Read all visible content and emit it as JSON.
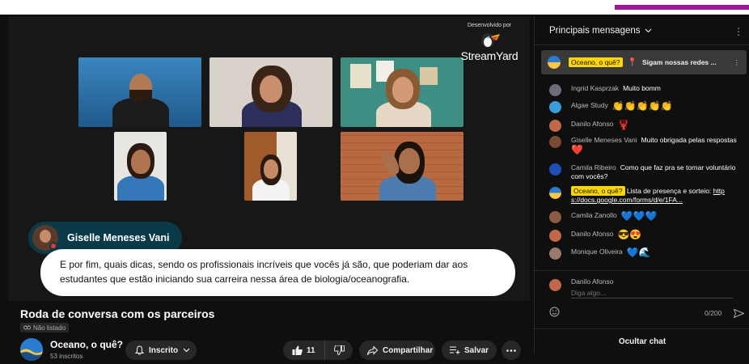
{
  "player": {
    "streamyard_small": "Desenvolvido por",
    "streamyard_name": "StreamYard",
    "speaker_name": "Giselle Meneses Vani",
    "caption": "E por fim, quais dicas, sendo os profissionais incríveis que vocês já são, que poderiam dar aos estudantes que estão iniciando sua carreira nessa área de biologia/oceanografia."
  },
  "video": {
    "title": "Roda de conversa com os parceiros",
    "visibility": "Não listado"
  },
  "channel": {
    "name": "Oceano, o quê?",
    "subs": "53 inscritos",
    "subscribed_label": "Inscrito"
  },
  "actions": {
    "likes": "11",
    "share_label": "Compartilhar",
    "save_label": "Salvar"
  },
  "chat": {
    "header": "Principais mensagens",
    "pinned_author": "Oceano, o quê?",
    "pinned_text": "Sigam nossas redes ...",
    "messages": [
      {
        "author": "Ingrid Kasprzak",
        "text": "Muito bomm",
        "emoji": ""
      },
      {
        "author": "Algae Study",
        "text": "",
        "emoji": "👏👏👏👏👏"
      },
      {
        "author": "Danilo Afonso",
        "text": "",
        "emoji": "🦞"
      },
      {
        "author": "Giselle Meneses Vani",
        "text": "Muito obrigada pelas respostas",
        "emoji": "❤️"
      },
      {
        "author": "Camila Ribeiro",
        "text": "Como que faz pra se tornar voluntário com vocês?",
        "emoji": ""
      },
      {
        "author": "Oceano, o quê?",
        "text": "Lista de presença e sorteio:",
        "link": "http s://docs.google.com/forms/d/e/1FA...",
        "emoji": ""
      },
      {
        "author": "Camila Zanollo",
        "text": "",
        "emoji": "💙💙💙"
      },
      {
        "author": "Danilo Afonso",
        "text": "",
        "emoji": "😎😍"
      },
      {
        "author": "Monique Oliveira",
        "text": "",
        "emoji": "💙🌊"
      }
    ],
    "input_user": "Danilo Afonso",
    "input_placeholder": "Diga algo...",
    "char_count": "0/200",
    "hide_chat": "Ocultar chat"
  },
  "colors": {
    "highlight": "#ffd600",
    "accent_bar": "#a3169c",
    "speaker_tag": "#0a3a47"
  }
}
